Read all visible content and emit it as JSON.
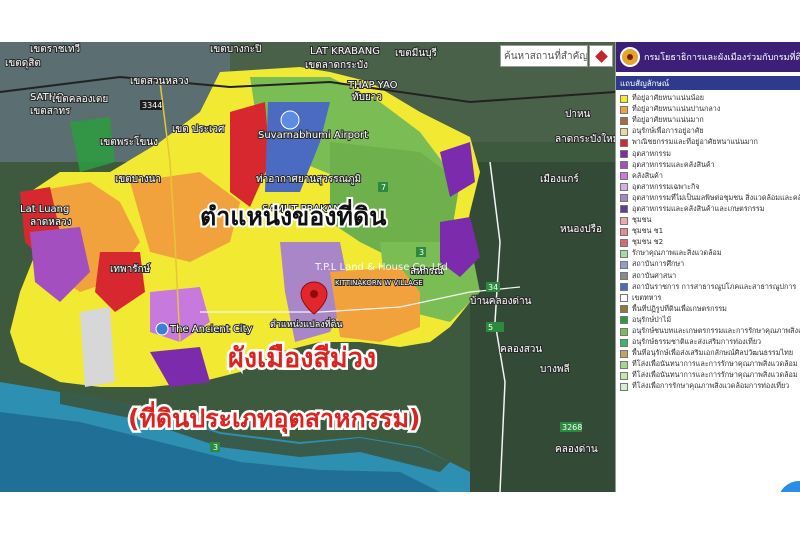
{
  "map": {
    "place_labels": [
      "เขตราชเทวี",
      "เขตดุสิต",
      "เขตบางกะปิ",
      "เขตมีนบุรี",
      "LAT KRABANG",
      "เขตลาดกระบัง",
      "เขตสวนหลวง",
      "SATHO",
      "เขตคลองเตย",
      "เขตสาทร",
      "เขต ประเวศ",
      "THAP YAO",
      "ทับยาว",
      "เขตพระโขนง",
      "เขตบางนา",
      "Suvarnabhumi Airport",
      "ท่าอากาศยานสุวรรณภูมิ",
      "SAMUT PRAKAN",
      "Lat Luang",
      "ลาดหลวง",
      "เทพารักษ์",
      "The Ancient City",
      "KITTINAKORN W VILLAGE",
      "สหกรณ์",
      "บ้านคลองด่าน",
      "เมืองแกร์",
      "ปาหน",
      "ลาดกระบังใหม่",
      "คลองด่าน",
      "บางพลี",
      "หนองปรือ",
      "คลองสวน"
    ],
    "road_shields": [
      "3344",
      "7",
      "9",
      "3",
      "3",
      "34",
      "3268",
      "5"
    ],
    "overlay_title": "ตำแหน่งของที่ดิน",
    "overlay_zone": "ผังเมืองสีม่วง",
    "overlay_category": "(ที่ดินประเภทอุตสาหกรรม)",
    "watermark": "T.P.L Land & House Co.,Ltd",
    "pin_label": "ตำแหน่งแปลงที่ดิน"
  },
  "search": {
    "placeholder": "ค้นหาสถานที่สำคัญ"
  },
  "legend": {
    "header": "กรมโยธาธิการและผังเมืองร่วมกับกรมที่ดิน",
    "subheader": "แถบสัญลักษณ์",
    "items": [
      {
        "label": "ที่อยู่อาศัยหนาแน่นน้อย",
        "color": "#f2ea32"
      },
      {
        "label": "ที่อยู่อาศัยหนาแน่นปานกลาง",
        "color": "#f2a23c"
      },
      {
        "label": "ที่อยู่อาศัยหนาแน่นมาก",
        "color": "#a26c3e"
      },
      {
        "label": "อนุรักษ์เพื่อการอยู่อาศัย",
        "color": "#efd79a"
      },
      {
        "label": "พาณิชยกรรมและที่อยู่อาศัยหนาแน่นมาก",
        "color": "#d72830"
      },
      {
        "label": "อุตสาหกรรม",
        "color": "#7b2bab"
      },
      {
        "label": "อุตสาหกรรมและคลังสินค้า",
        "color": "#a44fbf"
      },
      {
        "label": "คลังสินค้า",
        "color": "#c879dd"
      },
      {
        "label": "อุตสาหกรรมเฉพาะกิจ",
        "color": "#d5b0e6"
      },
      {
        "label": "อุตสาหกรรมที่ไม่เป็นมลพิษต่อชุมชน สิ่งแวดล้อมและคลังสินค้า",
        "color": "#a986c7"
      },
      {
        "label": "อุตสาหกรรมและคลังสินค้าและเกษตรกรรม",
        "color": "#5e3e9a"
      },
      {
        "label": "ชุมชน",
        "color": "#eeaab0"
      },
      {
        "label": "ชุมชน ช1",
        "color": "#e58a92"
      },
      {
        "label": "ชุมชน ช2",
        "color": "#d66a74"
      },
      {
        "label": "รักษาคุณภาพและสิ่งแวดล้อม",
        "color": "#9fdcaa"
      },
      {
        "label": "สถาบันการศึกษา",
        "color": "#8e9fc9"
      },
      {
        "label": "สถาบันศาสนา",
        "color": "#8a8a8a"
      },
      {
        "label": "สถาบันราชการ การสาธารณูปโภคและสาธารณูปการ",
        "color": "#4b6bc2"
      },
      {
        "label": "เขตทหาร",
        "color": "#ffffff"
      },
      {
        "label": "พื้นที่ปฏิรูปที่ดินเพื่อเกษตรกรรม",
        "color": "#8f7a38"
      },
      {
        "label": "อนุรักษ์ป่าไม้",
        "color": "#2d9c3e"
      },
      {
        "label": "อนุรักษ์ชนบทและเกษตรกรรมและการรักษาคุณภาพสิ่งแวดล้อม",
        "color": "#7bbd55"
      },
      {
        "label": "อนุรักษ์ธรรมชาติและส่งเสริมการท่องเที่ยว",
        "color": "#3bb36a"
      },
      {
        "label": "พื้นที่อนุรักษ์เพื่อส่งเสริมเอกลักษณ์ศิลปวัฒนธรรมไทย",
        "color": "#c5a05a"
      },
      {
        "label": "ที่โล่งเพื่อนันทนาการและการรักษาคุณภาพสิ่งแวดล้อม",
        "color": "#a7d78a"
      },
      {
        "label": "ที่โล่งเพื่อนันทนาการและการรักษาคุณภาพสิ่งแวดล้อม",
        "color": "#c9e6b0"
      },
      {
        "label": "ที่โล่งเพื่อการรักษาคุณภาพสิ่งแวดล้อมการท่องเที่ยว",
        "color": "#d7ecd0"
      }
    ]
  },
  "chat": {
    "label": "..."
  },
  "colors": {
    "header": "#3d1f78",
    "industrial_purple": "#7b2bab",
    "low_density_yellow": "#f2ea32",
    "commercial_red": "#d72830",
    "rural_green": "#7bbd55"
  }
}
